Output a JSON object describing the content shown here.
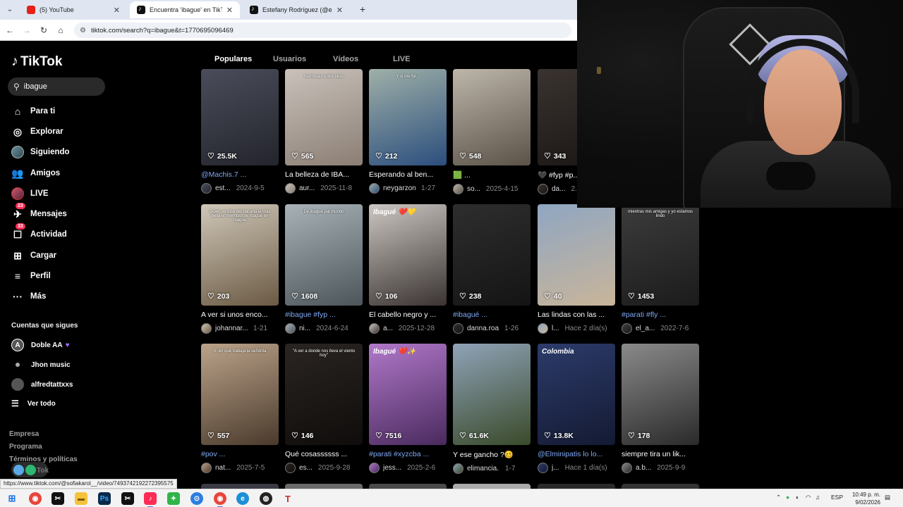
{
  "browser": {
    "tabs": [
      {
        "title": "(5) YouTube",
        "icon": "youtube-icon",
        "active": false
      },
      {
        "title": "Encuentra 'ibague' en TikTok | B",
        "icon": "tiktok-icon",
        "active": true
      },
      {
        "title": "Estefany Rodríguez (@estefany",
        "icon": "tiktok-icon",
        "active": false
      }
    ],
    "url": "tiktok.com/search?q=ibague&t=1770695096469",
    "status_url": "https://www.tiktok.com/@sofiakarol__/video/7493742192272395575"
  },
  "sidebar": {
    "logo": "TikTok",
    "search_value": "ibague",
    "nav": [
      {
        "label": "Para ti",
        "icon": "home-icon"
      },
      {
        "label": "Explorar",
        "icon": "compass-icon"
      },
      {
        "label": "Siguiendo",
        "icon": "avatar"
      },
      {
        "label": "Amigos",
        "icon": "friends-icon"
      },
      {
        "label": "LIVE",
        "icon": "live-avatar"
      },
      {
        "label": "Mensajes",
        "icon": "message-icon",
        "badge": "23"
      },
      {
        "label": "Actividad",
        "icon": "activity-icon",
        "badge": "33"
      },
      {
        "label": "Cargar",
        "icon": "upload-icon"
      },
      {
        "label": "Perfil",
        "icon": "profile-icon"
      },
      {
        "label": "Más",
        "icon": "more-icon"
      }
    ],
    "following_title": "Cuentas que sigues",
    "following": [
      "Doble AA",
      "Jhon music",
      "alfredtattxxs"
    ],
    "see_all": "Ver todo",
    "footer": [
      "Empresa",
      "Programa",
      "Términos y políticas"
    ],
    "footer_tiktok": "Tok"
  },
  "content": {
    "tabs": [
      "Populares",
      "Usuarios",
      "Vídeos",
      "LIVE"
    ],
    "videos": [
      {
        "likes": "25.5K",
        "desc": "@Machis.7 ...",
        "user": "est...",
        "date": "2024-9-5",
        "tag": true,
        "colors": [
          "#4a4d5a",
          "#23242c"
        ]
      },
      {
        "likes": "565",
        "desc": "La belleza de IBA...",
        "user": "aur...",
        "date": "2025-11-8",
        "colors": [
          "#c9c2bb",
          "#8b7e74"
        ],
        "overlay": "hermosas entre ellas"
      },
      {
        "likes": "212",
        "desc": "Esperando al ben...",
        "user": "neygarzon",
        "date": "1-27",
        "colors": [
          "#9fb0a8",
          "#2b4e7d"
        ],
        "overlay": "Y si me fui..."
      },
      {
        "likes": "548",
        "desc": "🟩 ...",
        "user": "so...",
        "date": "2025-4-15",
        "colors": [
          "#bdb6aa",
          "#5b5248"
        ]
      },
      {
        "likes": "343",
        "desc": "🖤 #fyp #p...",
        "user": "da...",
        "date": "2...",
        "colors": [
          "#3a3330",
          "#1a1614"
        ]
      },
      {
        "likes": "203",
        "desc": "A ver si unos enco...",
        "user": "johannar...",
        "date": "1-21",
        "colors": [
          "#cfc7b8",
          "#6b5a44"
        ],
        "overlay": "Quien se dice del bacana la mas bella el miembro de Ibagué en Ibague"
      },
      {
        "likes": "1608",
        "desc": "#ibague #fyp ...",
        "user": "ni...",
        "date": "2024-6-24",
        "tag": true,
        "colors": [
          "#a9b3b7",
          "#4c5559"
        ],
        "overlay": "De ibagué pal mundo"
      },
      {
        "likes": "106",
        "desc": "El cabello negro y ...",
        "user": "a...",
        "date": "2025-12-28",
        "colors": [
          "#cbc6c2",
          "#3a3331"
        ],
        "banner": "Ibagué ❤️💛"
      },
      {
        "likes": "238",
        "desc": "#ibagué ...",
        "user": "danna.roa",
        "date": "1-26",
        "tag": true,
        "colors": [
          "#2e2e2e",
          "#141414"
        ]
      },
      {
        "likes": "40",
        "desc": "Las lindas con las ...",
        "user": "l...",
        "date": "Hace 2 día(s)",
        "colors": [
          "#8fa6c2",
          "#c9b59a"
        ]
      },
      {
        "likes": "1453",
        "desc": "#parati #fly ...",
        "user": "el_a...",
        "date": "2022-7-6",
        "tag": true,
        "colors": [
          "#3c3c3c",
          "#1b1b1b"
        ],
        "overlay": "mientras mis amigas y yo estamos lindo"
      },
      {
        "likes": "557",
        "desc": "#pov ...",
        "user": "nat...",
        "date": "2025-7-5",
        "tag": true,
        "colors": [
          "#bba38a",
          "#4a3a2c"
        ],
        "overlay": "X: en qué trabaja la señorita"
      },
      {
        "likes": "146",
        "desc": "Qué cosassssss ...",
        "user": "es...",
        "date": "2025-9-28",
        "colors": [
          "#2a2522",
          "#0f0c0b"
        ],
        "overlay": "\"A ver a donde nos lleva el viento hoy\""
      },
      {
        "likes": "7516",
        "desc": "#parati #xyzcba ...",
        "user": "jess...",
        "date": "2025-2-6",
        "tag": true,
        "colors": [
          "#b078c9",
          "#4a2a5e"
        ],
        "banner": "Ibagué ❤️✨"
      },
      {
        "likes": "61.6K",
        "desc": "Y ese gancho ?🥴",
        "user": "elimancia...",
        "date": "1-7",
        "colors": [
          "#8fa3b8",
          "#3a4a2a"
        ]
      },
      {
        "likes": "13.8K",
        "desc": "@Elminipatis lo lo...",
        "user": "j...",
        "date": "Hace 1 día(s)",
        "tag": true,
        "colors": [
          "#2c3b6a",
          "#141a33"
        ],
        "banner": "Colombia"
      },
      {
        "likes": "178",
        "desc": "siempre tira un lik...",
        "user": "a.b...",
        "date": "2025-9-9",
        "colors": [
          "#8a8a8a",
          "#2a2a2a"
        ]
      }
    ]
  },
  "taskbar": {
    "apps": [
      "windows-icon",
      "chrome-icon",
      "capcut-icon",
      "file-explorer-icon",
      "photoshop-icon",
      "capcut-icon",
      "tiktok-icon",
      "green-app-icon",
      "blue-app-icon",
      "chrome-icon",
      "edge-icon",
      "obs-icon",
      "text-app-icon"
    ],
    "language": "ESP",
    "time": "10:49 p. m.",
    "date": "9/02/2026"
  }
}
